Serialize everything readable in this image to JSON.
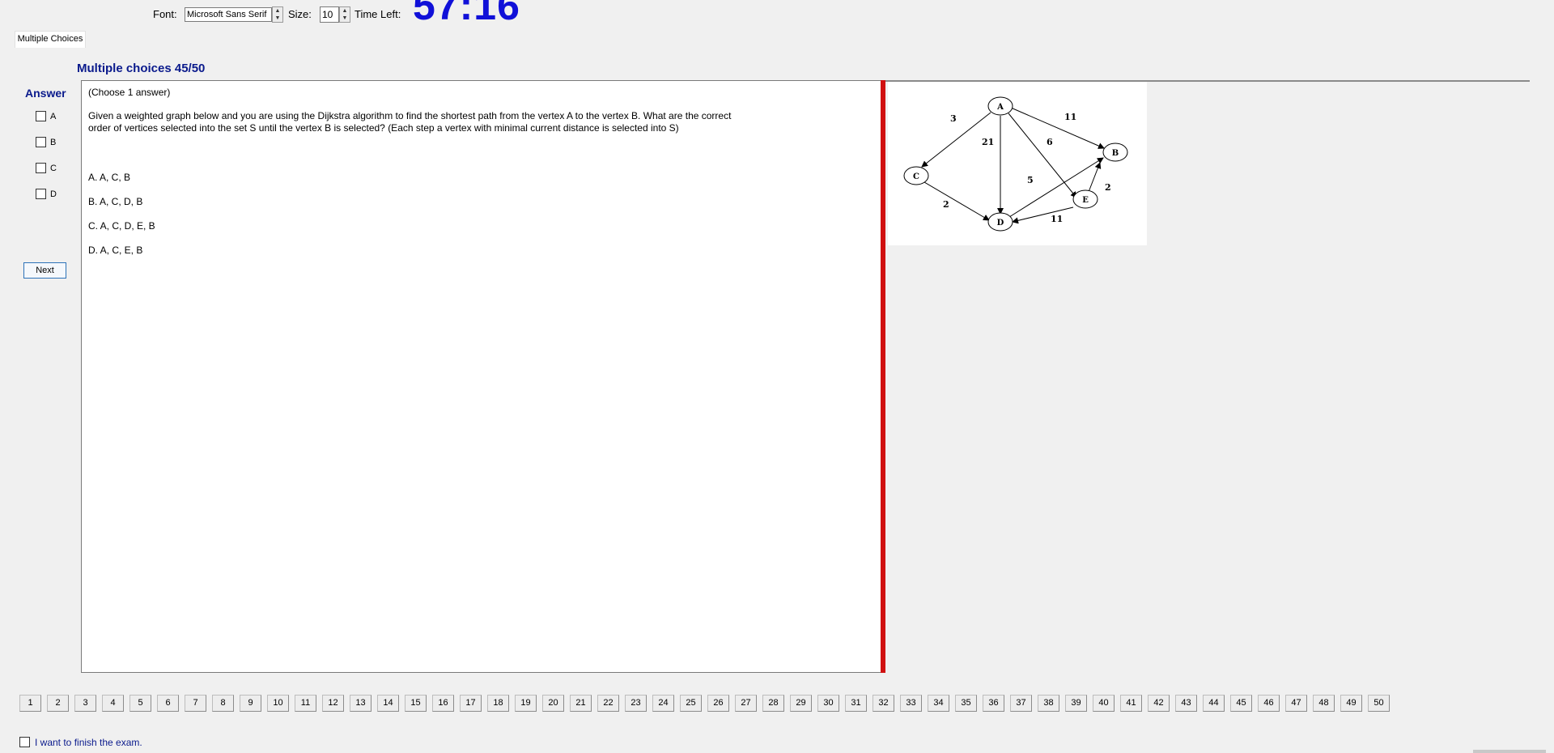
{
  "toolbar": {
    "font_label": "Font:",
    "font_value": "Microsoft Sans Serif",
    "size_label": "Size:",
    "size_value": "10",
    "time_label": "Time Left:",
    "time_value": "57:16"
  },
  "tab": {
    "label": "Multiple Choices"
  },
  "section_title": "Multiple choices 45/50",
  "answer_panel": {
    "title": "Answer",
    "options": [
      "A",
      "B",
      "C",
      "D"
    ],
    "next_label": "Next"
  },
  "question": {
    "instruction": "(Choose 1 answer)",
    "text": "Given a weighted graph below and you are using the Dijkstra algorithm to find the shortest path from the vertex  A  to the vertex  B. What are the correct order of vertices selected into the set  S until the vertex  B  is selected? (Each step a vertex with minimal current distance is selected into S)",
    "choices": [
      "A.  A, C, B",
      "B.  A, C, D, B",
      "C.  A, C, D, E, B",
      "D.  A, C,  E, B"
    ]
  },
  "graph": {
    "nodes": [
      "A",
      "B",
      "C",
      "D",
      "E"
    ],
    "edges": [
      {
        "from": "A",
        "to": "C",
        "weight": "3"
      },
      {
        "from": "A",
        "to": "D",
        "weight": "21"
      },
      {
        "from": "A",
        "to": "E",
        "weight": "6"
      },
      {
        "from": "A",
        "to": "B",
        "weight": "11"
      },
      {
        "from": "C",
        "to": "D",
        "weight": "2"
      },
      {
        "from": "D",
        "to": "B",
        "weight": "5"
      },
      {
        "from": "E",
        "to": "B",
        "weight": "2"
      },
      {
        "from": "E",
        "to": "D",
        "weight": "11"
      }
    ]
  },
  "navigation": {
    "pages": [
      "1",
      "2",
      "3",
      "4",
      "5",
      "6",
      "7",
      "8",
      "9",
      "10",
      "11",
      "12",
      "13",
      "14",
      "15",
      "16",
      "17",
      "18",
      "19",
      "20",
      "21",
      "22",
      "23",
      "24",
      "25",
      "26",
      "27",
      "28",
      "29",
      "30",
      "31",
      "32",
      "33",
      "34",
      "35",
      "36",
      "37",
      "38",
      "39",
      "40",
      "41",
      "42",
      "43",
      "44",
      "45",
      "46",
      "47",
      "48",
      "49",
      "50"
    ]
  },
  "finish_label": "I want to finish the exam.",
  "colors": {
    "accent_blue": "#0a1a8c",
    "timer_blue": "#1010d8",
    "splitter_red": "#d01010"
  }
}
